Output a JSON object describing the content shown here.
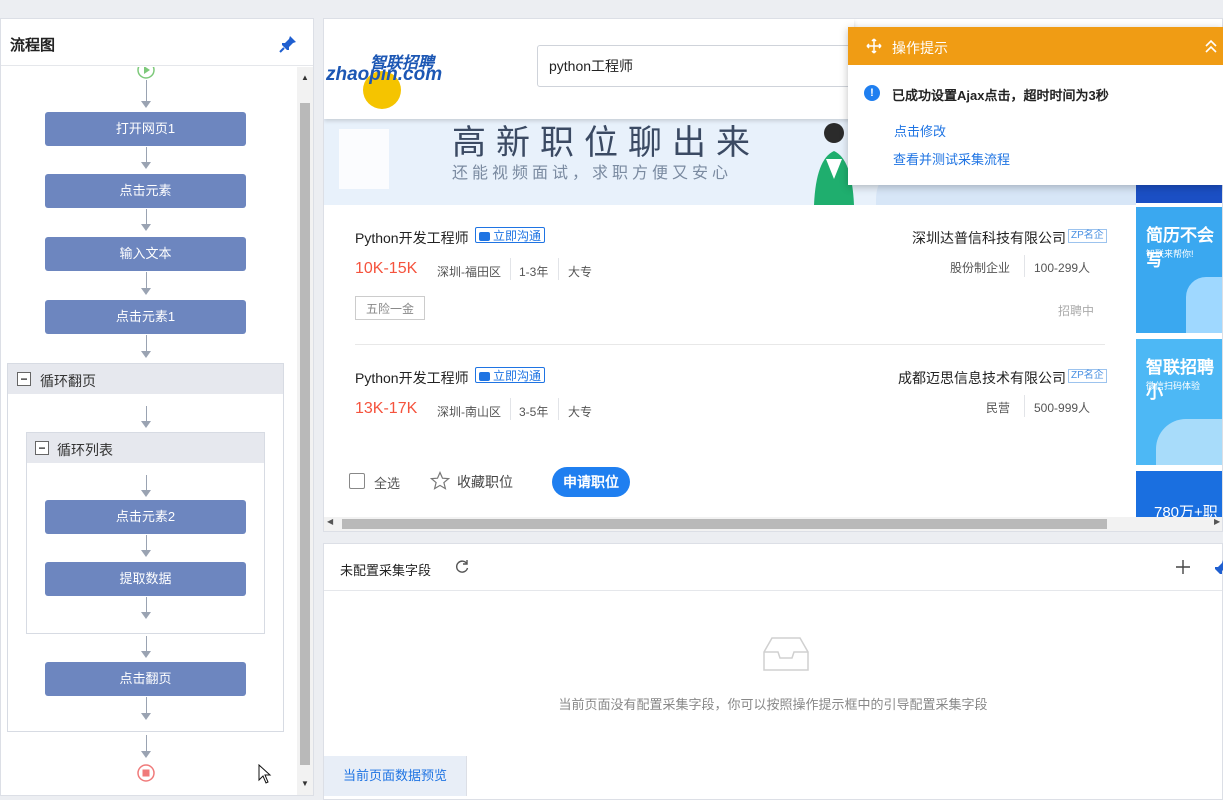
{
  "left_panel": {
    "title": "流程图",
    "flow_nodes": {
      "open_page": "打开网页1",
      "click_element": "点击元素",
      "input_text": "输入文本",
      "click_element1": "点击元素1",
      "loop_page": "循环翻页",
      "loop_list": "循环列表",
      "click_element2": "点击元素2",
      "extract_data": "提取数据",
      "click_next_page": "点击翻页"
    }
  },
  "browser": {
    "search_value": "python工程师",
    "logo_text_cn": "智联招聘",
    "logo_text_en": "zhaopin.com",
    "banner_title": "高新职位聊出来",
    "banner_subtitle": "还能视频面试，求职方便又安心",
    "jobs": [
      {
        "title": "Python开发工程师",
        "chat_label": "立即沟通",
        "salary": "10K-15K",
        "location": "深圳-福田区",
        "experience": "1-3年",
        "education": "大专",
        "company": "深圳达普信科技有限公司",
        "company_badge": "ZP名企",
        "company_type": "股份制企业",
        "company_size": "100-299人",
        "welfare": "五险一金",
        "status": "招聘中"
      },
      {
        "title": "Python开发工程师",
        "chat_label": "立即沟通",
        "salary": "13K-17K",
        "location": "深圳-南山区",
        "experience": "3-5年",
        "education": "大专",
        "company": "成都迈思信息技术有限公司",
        "company_badge": "ZP名企",
        "company_type": "民营",
        "company_size": "500-999人"
      }
    ],
    "actions": {
      "select_all": "全选",
      "favorite": "收藏职位",
      "apply": "申请职位"
    },
    "ads": {
      "resume": "简历不会写",
      "resume_sub": "智联来帮你!",
      "app": "智联招聘小",
      "app_sub": "微信扫码体验",
      "count": "780万+职"
    }
  },
  "tooltip": {
    "title": "操作提示",
    "message": "已成功设置Ajax点击，超时时间为3秒",
    "link_modify": "点击修改",
    "link_test": "查看并测试采集流程"
  },
  "bottom_panel": {
    "title": "未配置采集字段",
    "empty_message": "当前页面没有配置采集字段，你可以按照操作提示框中的引导配置采集字段",
    "tab_label": "当前页面数据预览"
  },
  "colors": {
    "node": "#6d86bf",
    "tooltip_header": "#f09c14",
    "accent_blue": "#1f7ff0",
    "salary_red": "#f5533d"
  }
}
